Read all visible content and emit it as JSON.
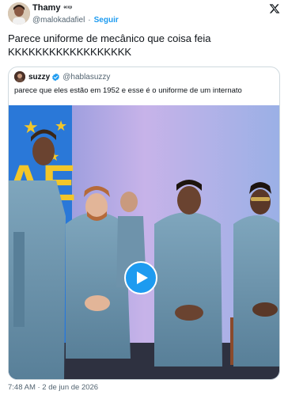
{
  "author": {
    "name": "Thamy",
    "name_emoji": "ᵉᶜᶜᵖ",
    "handle": "@malokadafiel",
    "follow_label": "Seguir"
  },
  "tweet": {
    "text": "Parece uniforme de mecânico que coisa feia\nKKKKKKKKKKKKKKKKKK"
  },
  "quoted": {
    "name": "suzzy",
    "handle": "@hablasuzzy",
    "text": "parece que eles estão em 1952 e esse é o uniforme de um internato"
  },
  "media": {
    "type": "video",
    "play_icon": "play-icon"
  },
  "timestamp": "7:48 AM · 2 de jun de 2026",
  "colors": {
    "accent": "#1d9bf0",
    "text": "#0f1419",
    "muted": "#536471",
    "border": "#cfd9de"
  }
}
